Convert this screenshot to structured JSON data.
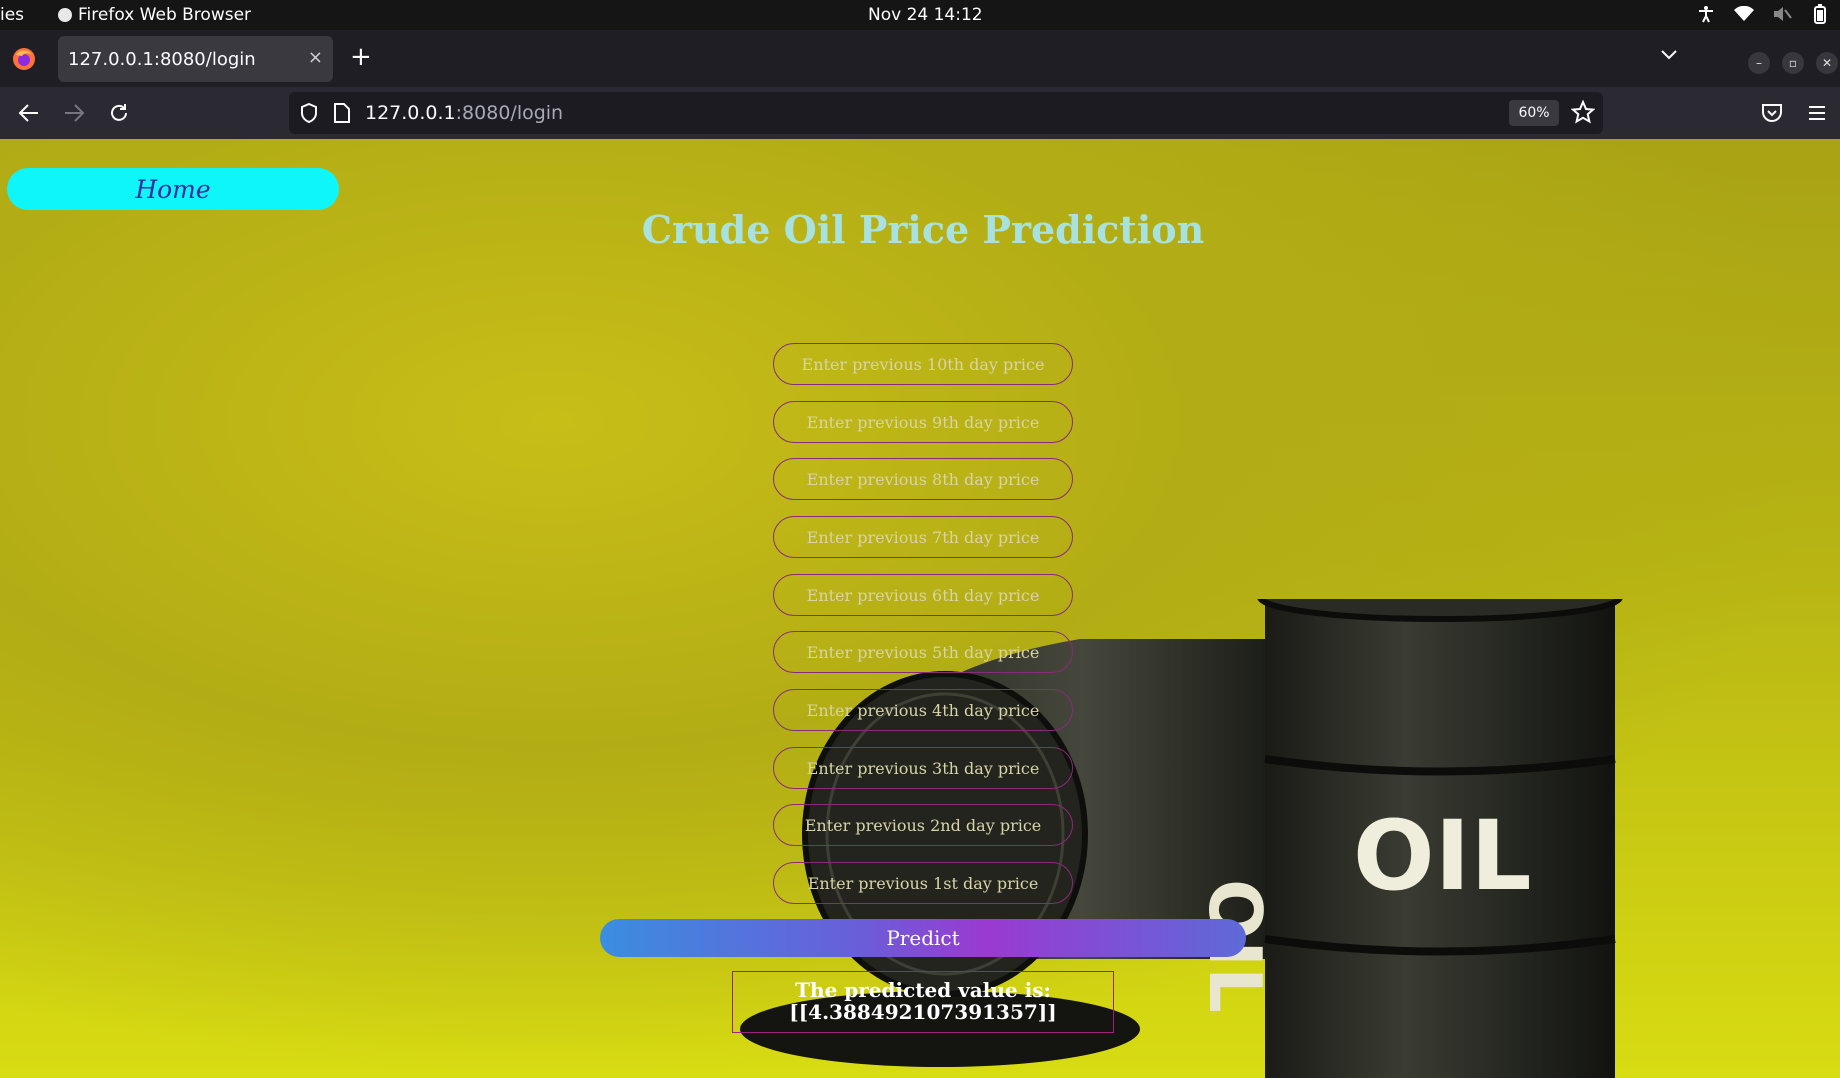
{
  "system_bar": {
    "activities": "ies",
    "app_name": "Firefox Web Browser",
    "clock": "Nov 24  14:12"
  },
  "browser": {
    "tab_title": "127.0.0.1:8080/login",
    "tab_close": "×",
    "new_tab": "+",
    "url_host": "127.0.0.1",
    "url_path": ":8080/login",
    "zoom": "60%"
  },
  "page": {
    "home_label": "Home",
    "title": "Crude Oil Price Prediction",
    "fields": [
      {
        "placeholder": "Enter previous 10th day price",
        "value": ""
      },
      {
        "placeholder": "Enter previous 9th day price",
        "value": ""
      },
      {
        "placeholder": "Enter previous 8th day price",
        "value": ""
      },
      {
        "placeholder": "Enter previous 7th day price",
        "value": ""
      },
      {
        "placeholder": "Enter previous 6th day price",
        "value": ""
      },
      {
        "placeholder": "Enter previous 5th day price",
        "value": ""
      },
      {
        "placeholder": "Enter previous 4th day price",
        "value": ""
      },
      {
        "placeholder": "Enter previous 3th day price",
        "value": ""
      },
      {
        "placeholder": "Enter previous 2nd day price",
        "value": ""
      },
      {
        "placeholder": "Enter previous 1st day price",
        "value": ""
      }
    ],
    "predict_label": "Predict",
    "result_label": "The predicted value is:",
    "result_value": "[[4.388492107391357]]",
    "barrel_label": "OIL",
    "barrel_label_back": "OIL"
  },
  "colors": {
    "home_bg": "#0ff6f8",
    "title": "#a7e2e0",
    "field_border": "#8a2a7a"
  }
}
